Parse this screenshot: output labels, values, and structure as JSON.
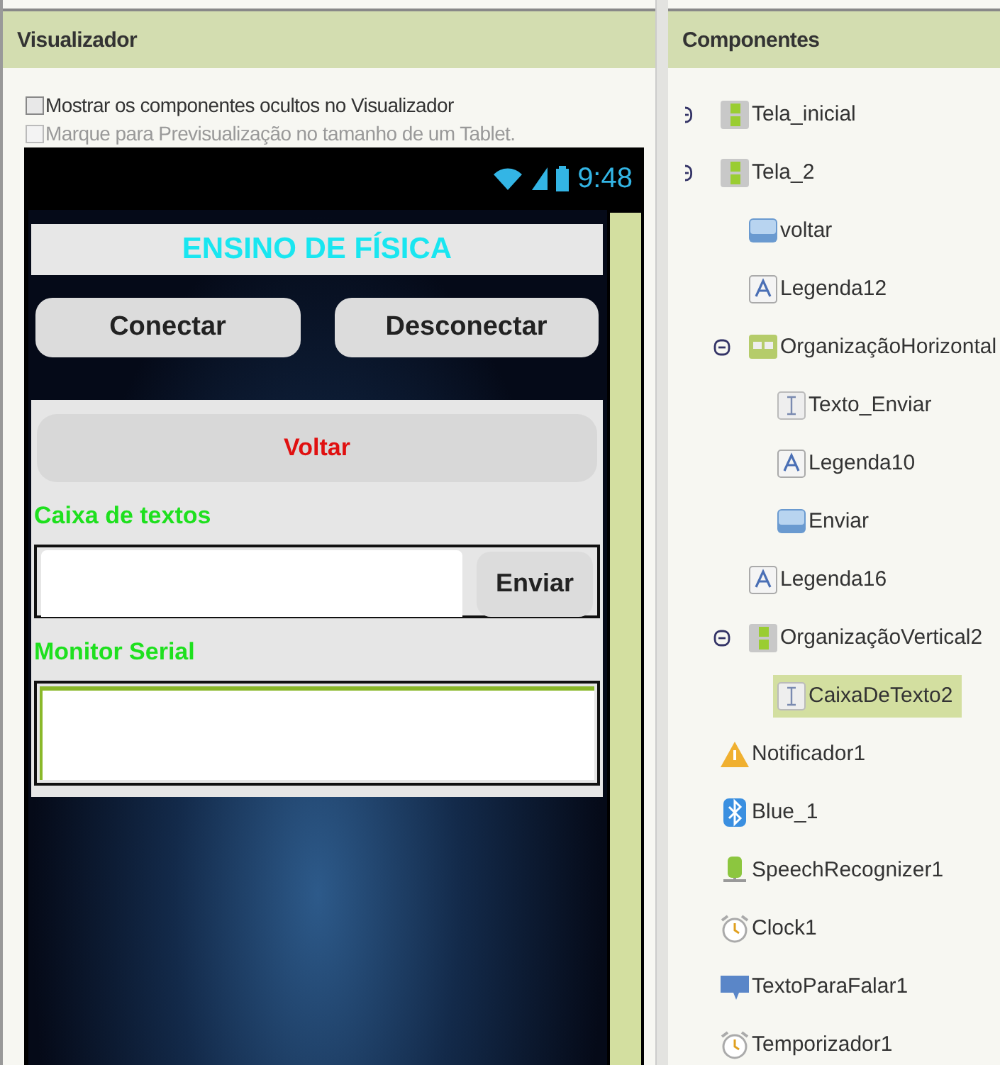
{
  "viewer": {
    "title": "Visualizador",
    "options": [
      {
        "label": "Mostrar os componentes ocultos no Visualizador",
        "checked": false,
        "disabled": false
      },
      {
        "label": "Marque para Previsualização no tamanho de um Tablet.",
        "checked": false,
        "disabled": true
      }
    ],
    "phone": {
      "status_time": "9:48",
      "title": "ENSINO DE FÍSICA",
      "top_buttons": [
        "Conectar",
        "Desconectar"
      ],
      "back_button": "Voltar",
      "text_label": "Caixa de textos",
      "send_button": "Enviar",
      "monitor_label": "Monitor Serial"
    }
  },
  "components": {
    "title": "Componentes",
    "tree": [
      {
        "label": "Tela_inicial",
        "kind": "screen",
        "selected": false,
        "expanded": true
      },
      {
        "label": "Tela_2",
        "kind": "screen",
        "selected": false,
        "expanded": true,
        "children": [
          {
            "label": "voltar",
            "kind": "button",
            "selected": false
          },
          {
            "label": "Legenda12",
            "kind": "label",
            "selected": false
          },
          {
            "label": "OrganizaçãoHorizontal",
            "kind": "horizontal",
            "selected": false,
            "expanded": true,
            "children": [
              {
                "label": "Texto_Enviar",
                "kind": "textbox",
                "selected": false
              },
              {
                "label": "Legenda10",
                "kind": "label",
                "selected": false
              },
              {
                "label": "Enviar",
                "kind": "button",
                "selected": false
              }
            ]
          },
          {
            "label": "Legenda16",
            "kind": "label",
            "selected": false
          },
          {
            "label": "OrganizaçãoVertical2",
            "kind": "vertical",
            "selected": false,
            "expanded": true,
            "children": [
              {
                "label": "CaixaDeTexto2",
                "kind": "textbox",
                "selected": true
              }
            ]
          }
        ]
      },
      {
        "label": "Notificador1",
        "kind": "notifier",
        "selected": false
      },
      {
        "label": "Blue_1",
        "kind": "bluetooth",
        "selected": false
      },
      {
        "label": "SpeechRecognizer1",
        "kind": "speech",
        "selected": false
      },
      {
        "label": "Clock1",
        "kind": "clock",
        "selected": false
      },
      {
        "label": "TextoParaFalar1",
        "kind": "tts",
        "selected": false
      },
      {
        "label": "Temporizador1",
        "kind": "clock",
        "selected": false
      }
    ]
  }
}
